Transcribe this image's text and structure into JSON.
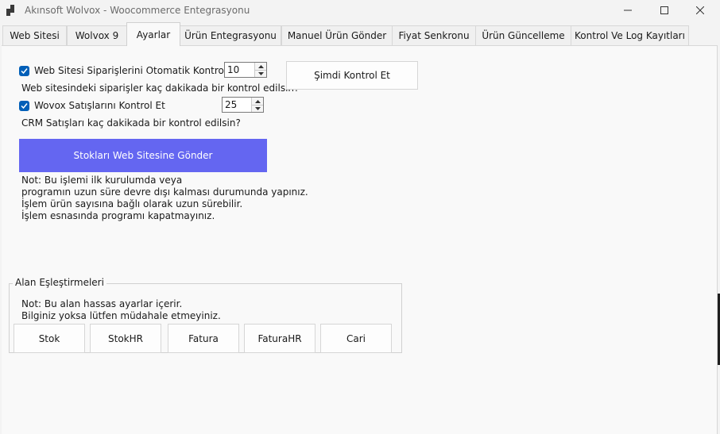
{
  "window": {
    "title": "Akınsoft Wolvox - Woocommerce Entegrasyonu",
    "controls": {
      "minimize_icon": "minimize-icon",
      "maximize_icon": "maximize-icon",
      "close_icon": "close-icon"
    }
  },
  "tabs": [
    {
      "label": "Web Sitesi"
    },
    {
      "label": "Wolvox 9"
    },
    {
      "label": "Ayarlar",
      "active": true
    },
    {
      "label": "Ürün Entegrasyonu"
    },
    {
      "label": "Manuel Ürün Gönder"
    },
    {
      "label": "Fiyat Senkronu"
    },
    {
      "label": "Ürün Güncelleme"
    },
    {
      "label": "Kontrol Ve Log Kayıtları"
    }
  ],
  "settings": {
    "order_check": {
      "label": "Web Sitesi Siparişlerini Otomatik Kontrol Et",
      "checked": true,
      "interval": "10"
    },
    "order_hint": "Web sitesindeki siparişler kaç dakikada bir kontrol edilsin?",
    "sales_check": {
      "label": "Wovox Satışlarını Kontrol Et",
      "checked": true,
      "interval": "25"
    },
    "sales_hint": "CRM Satışları kaç dakikada bir kontrol edilsin?",
    "check_now_label": "Şimdi Kontrol Et",
    "send_stock_label": "Stokları Web Sitesine Gönder",
    "note_lines": [
      "Not: Bu işlemi ilk kurulumda veya",
      "programın uzun süre devre dışı kalması durumunda yapınız.",
      "İşlem ürün sayısına bağlı olarak uzun sürebilir.",
      "İşlem esnasında programı kapatmayınız."
    ]
  },
  "field_mapping": {
    "title": "Alan Eşleştirmeleri",
    "note_lines": [
      "Not: Bu alan hassas ayarlar içerir.",
      "Bilginiz yoksa lütfen müdahale etmeyiniz."
    ],
    "buttons": [
      "Stok",
      "StokHR",
      "Fatura",
      "FaturaHR",
      "Cari"
    ]
  },
  "colors": {
    "accent": "#6466f1",
    "checkbox": "#005fb8"
  }
}
